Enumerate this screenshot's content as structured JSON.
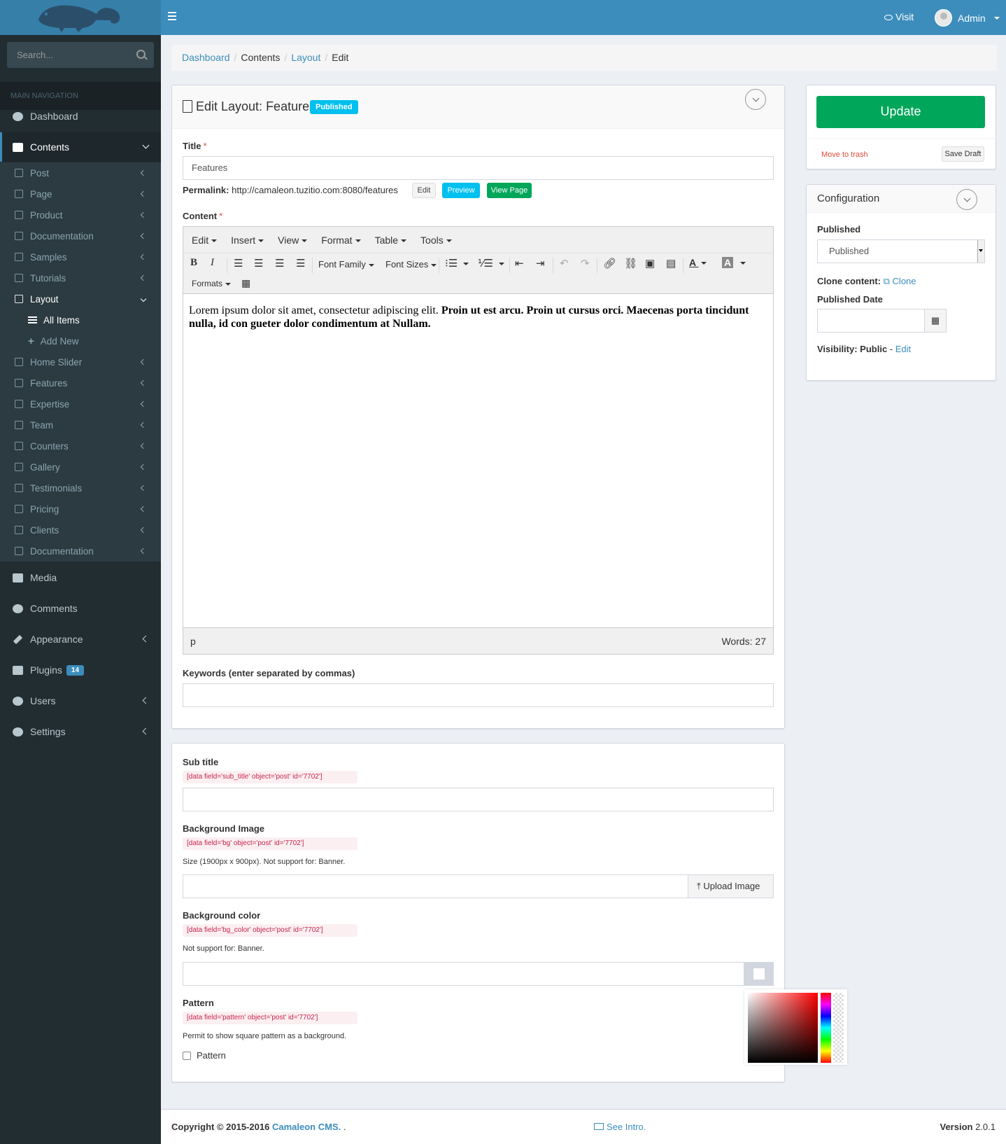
{
  "header": {
    "visit_label": "Visit",
    "admin_label": "Admin"
  },
  "sidebar": {
    "search_placeholder": "Search...",
    "nav_header": "MAIN NAVIGATION",
    "dashboard": "Dashboard",
    "contents": "Contents",
    "content_items": [
      "Post",
      "Page",
      "Product",
      "Documentation",
      "Samples",
      "Tutorials"
    ],
    "layout": "Layout",
    "layout_all_items": "All Items",
    "layout_add_new": "Add New",
    "content_items_2": [
      "Home Slider",
      "Features",
      "Expertise",
      "Team",
      "Counters",
      "Gallery",
      "Testimonials",
      "Pricing",
      "Clients",
      "Documentation"
    ],
    "media": "Media",
    "comments": "Comments",
    "appearance": "Appearance",
    "plugins": "Plugins",
    "plugins_badge": "14",
    "users": "Users",
    "settings": "Settings"
  },
  "breadcrumb": {
    "items": [
      "Dashboard",
      "Contents",
      "Layout",
      "Edit"
    ]
  },
  "edit_box": {
    "title": "Edit Layout: Features",
    "status_badge": "Published",
    "title_label": "Title",
    "title_value": "Features",
    "permalink_label": "Permalink:",
    "permalink_url": "http://camaleon.tuzitio.com:8080/features",
    "edit_btn": "Edit",
    "preview_btn": "Preview",
    "view_page_btn": "View Page",
    "content_label": "Content",
    "menubar": [
      "Edit",
      "Insert",
      "View",
      "Format",
      "Table",
      "Tools"
    ],
    "font_family": "Font Family",
    "font_sizes": "Font Sizes",
    "formats": "Formats",
    "body_text_normal": "Lorem ipsum dolor sit amet, consectetur adipiscing elit. ",
    "body_text_bold": "Proin ut est arcu. Proin ut cursus orci. Maecenas porta tincidunt nulla, id con gueter dolor condimentum at Nullam.",
    "status_path": "p",
    "word_count": "Words: 27",
    "keywords_label": "Keywords (enter separated by commas)"
  },
  "fields_box": {
    "sub_title_label": "Sub title",
    "sub_title_tag": "[data field='sub_title' object='post' id='7702']",
    "bg_image_label": "Background Image",
    "bg_image_tag": "[data field='bg' object='post' id='7702']",
    "bg_image_help": "Size (1900px x 900px). Not support for: Banner.",
    "upload_label": "Upload Image",
    "bg_color_label": "Background color",
    "bg_color_tag": "[data field='bg_color' object='post' id='7702']",
    "bg_color_help": "Not support for: Banner.",
    "pattern_label": "Pattern",
    "pattern_tag": "[data field='pattern' object='post' id='7702']",
    "pattern_help": "Permit to show square pattern as a background.",
    "pattern_checkbox": "Pattern"
  },
  "publish_box": {
    "update_btn": "Update",
    "trash_link": "Move to trash",
    "save_draft": "Save Draft"
  },
  "config_box": {
    "title": "Configuration",
    "published_label": "Published",
    "published_value": "Published",
    "clone_label": "Clone content:",
    "clone_link": "Clone",
    "date_label": "Published Date",
    "visibility_label": "Visibility: Public",
    "visibility_edit": "Edit"
  },
  "footer": {
    "copyright": "Copyright © 2015-2016",
    "brand": "Camaleon CMS.",
    "dot": " .",
    "see_intro": "See Intro.",
    "version_label": "Version",
    "version": "2.0.1"
  },
  "colors": {
    "primary": "#3c8dbc",
    "sidebar": "#222d32",
    "success": "#00a65a",
    "info": "#00c0ef",
    "danger": "#dd4b39"
  }
}
